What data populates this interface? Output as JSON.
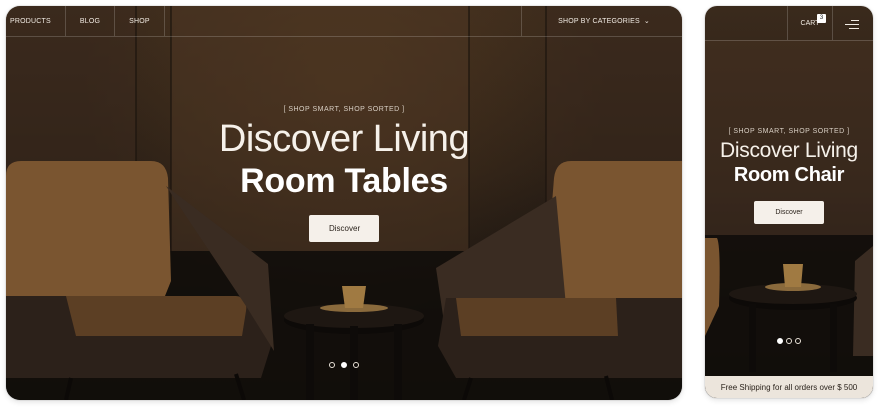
{
  "desktop": {
    "nav": {
      "products": "PRODUCTS",
      "blog": "BLOG",
      "shop": "SHOP",
      "categories": "SHOP BY CATEGORIES"
    },
    "hero": {
      "tagline": "[ SHOP SMART, SHOP SORTED ]",
      "title_light": "Discover Living",
      "title_bold": "Room Tables",
      "button": "Discover"
    },
    "slides": {
      "count": 3,
      "active_index": 1
    }
  },
  "mobile": {
    "nav": {
      "cart": "CART",
      "cart_count": "3"
    },
    "hero": {
      "tagline": "[ SHOP SMART, SHOP SORTED ]",
      "title_light": "Discover Living",
      "title_bold": "Room Chair",
      "button": "Discover"
    },
    "slides": {
      "count": 3,
      "active_index": 0
    },
    "shipping_bar": "Free Shipping for all orders over $ 500"
  },
  "icons": {
    "chevron": "chevron-down-icon",
    "menu": "menu-icon"
  },
  "colors": {
    "hero_dark": "#1b1511",
    "hero_warm": "#3a2a1c",
    "chair_fabric": "#7a5530",
    "button_bg": "#f5f0ea",
    "shipping_bg": "#ece5dc"
  }
}
